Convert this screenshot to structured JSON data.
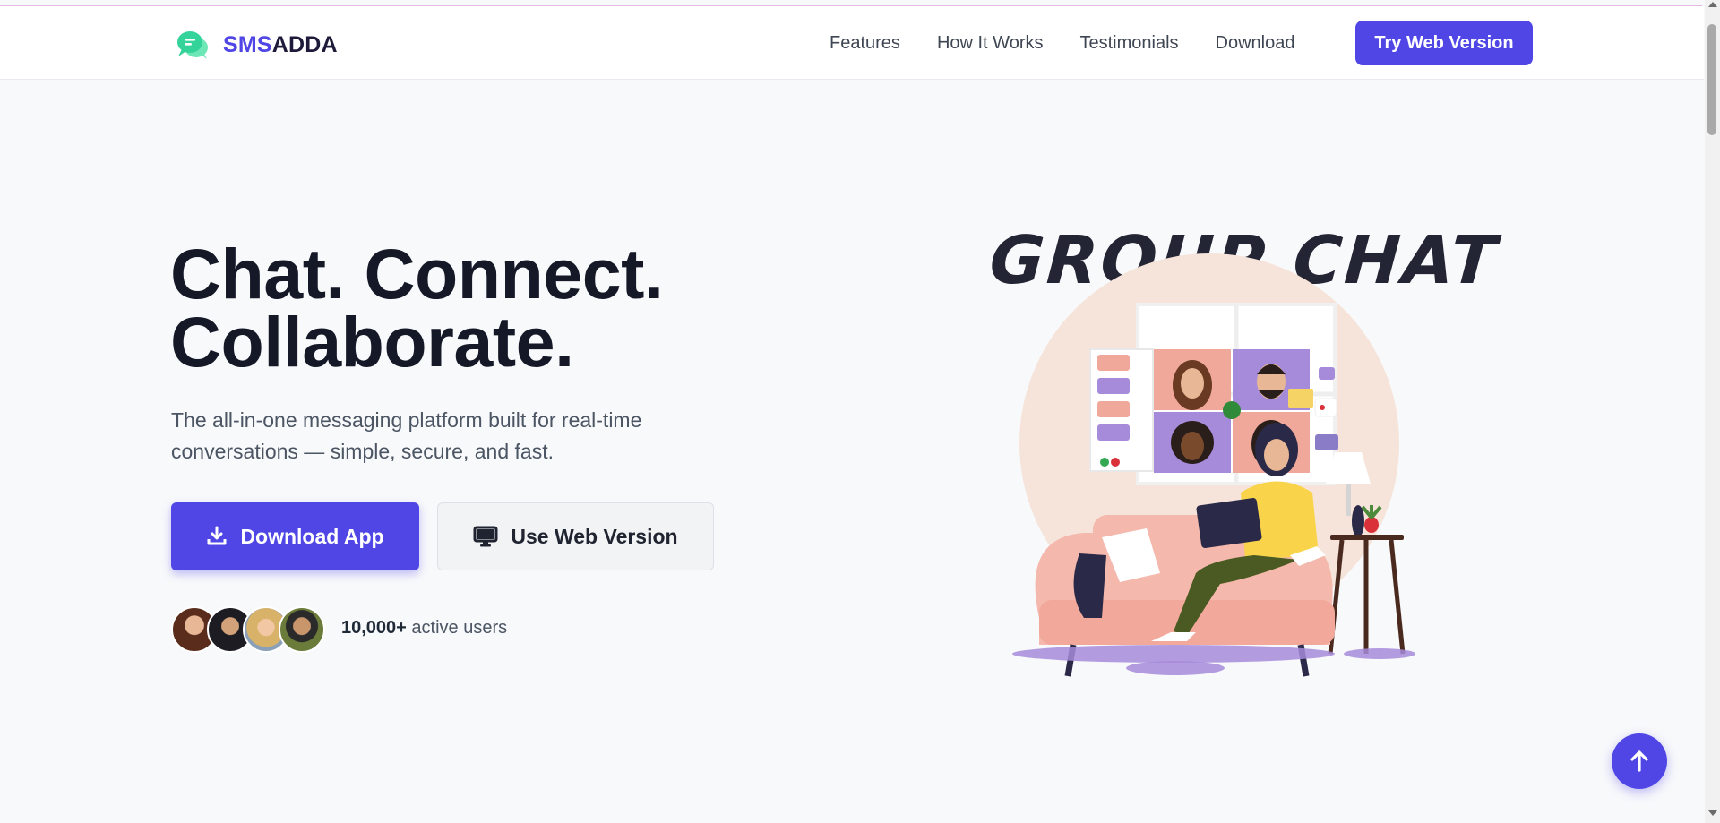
{
  "brand": {
    "name_part1": "SMS",
    "name_part2": "ADDA",
    "logo_icon": "chat-bubbles-icon",
    "accent_color": "#4f46e5",
    "icon_color": "#34d399"
  },
  "nav": {
    "links": [
      "Features",
      "How It Works",
      "Testimonials",
      "Download"
    ],
    "cta_label": "Try Web Version"
  },
  "hero": {
    "title_line1": "Chat. Connect.",
    "title_line2": "Collaborate.",
    "subtitle": "The all-in-one messaging platform built for real-time conversations — simple, secure, and fast.",
    "download_label": "Download App",
    "download_icon": "download-icon",
    "web_label": "Use Web Version",
    "web_icon": "monitor-icon",
    "users_count": "10,000+",
    "users_text": " active users"
  },
  "illustration": {
    "title": "GROUP CHAT"
  },
  "fab": {
    "icon": "arrow-up-icon"
  }
}
